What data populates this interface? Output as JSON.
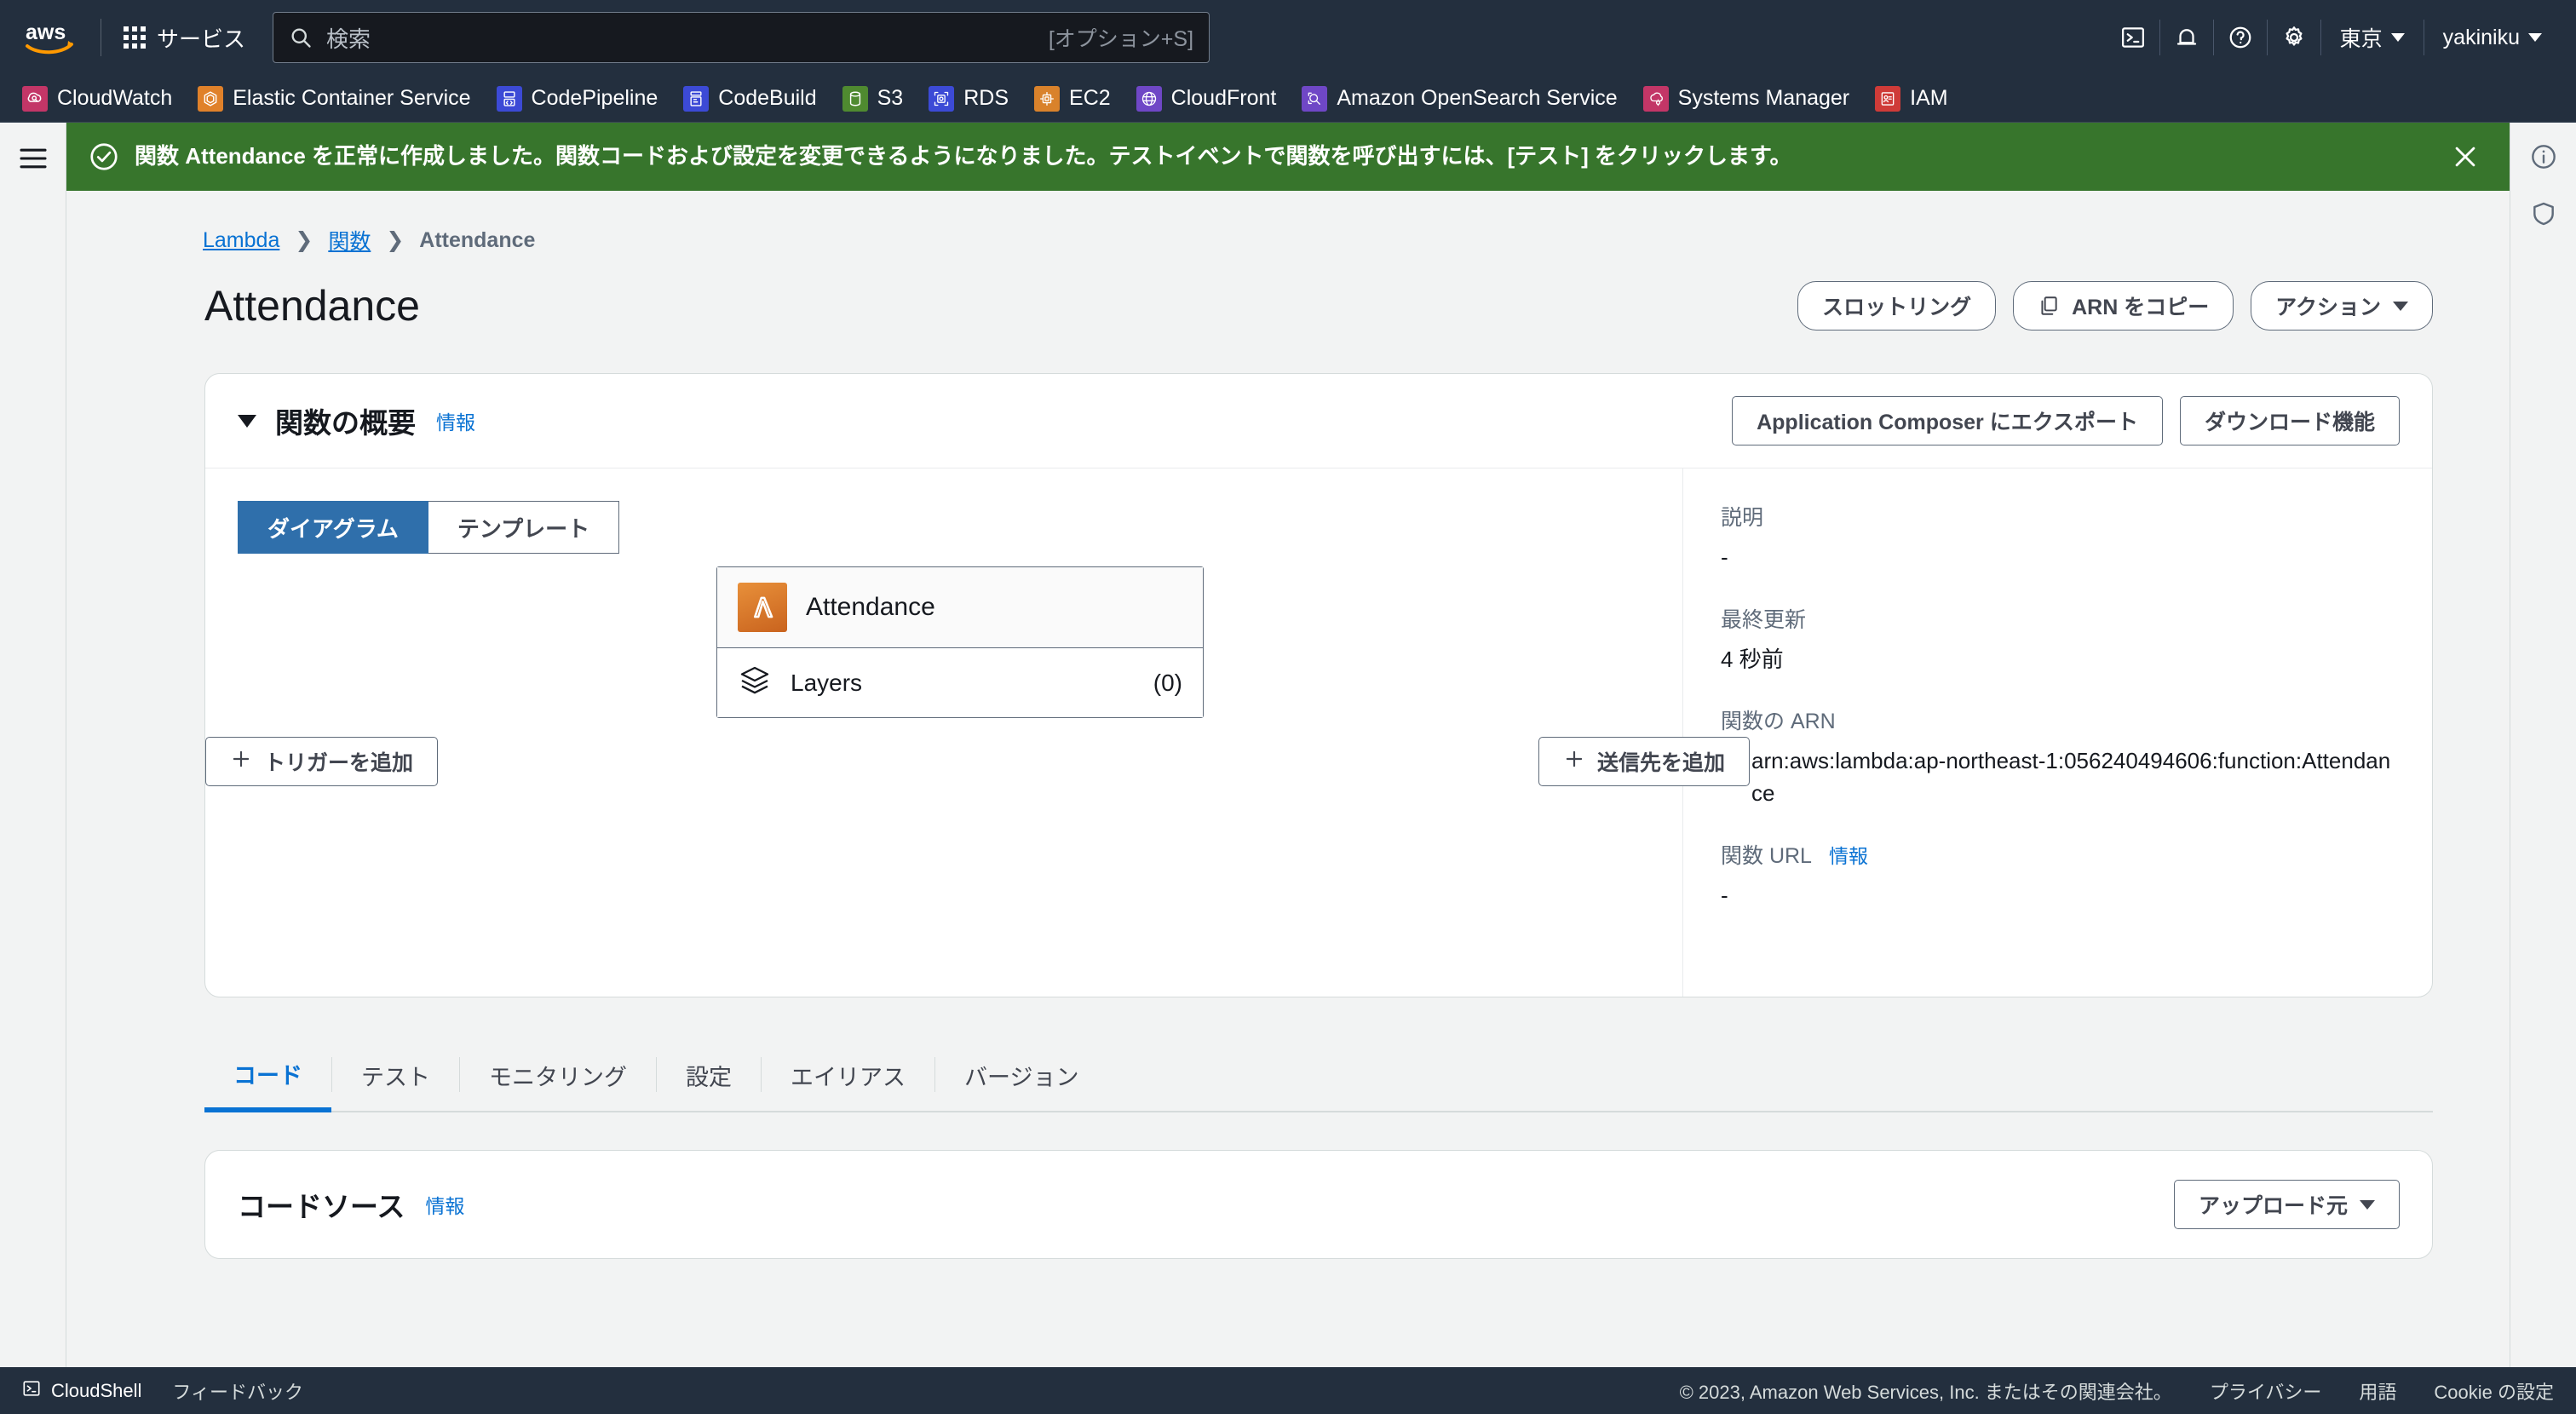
{
  "topnav": {
    "logo_alt": "aws",
    "services_label": "サービス",
    "search": {
      "placeholder": "検索",
      "shortcut": "[オプション+S]"
    },
    "icons": [
      "cloudshell-icon",
      "bell-icon",
      "help-icon",
      "settings-icon"
    ],
    "region": "東京",
    "account": "yakiniku"
  },
  "service_bar": [
    {
      "label": "CloudWatch",
      "color": "#c33667",
      "icon": "cloudwatch-icon"
    },
    {
      "label": "Elastic Container Service",
      "color": "#e0812a",
      "icon": "ecs-icon"
    },
    {
      "label": "CodePipeline",
      "color": "#3c4ad6",
      "icon": "codepipeline-icon"
    },
    {
      "label": "CodeBuild",
      "color": "#3c4ad6",
      "icon": "codebuild-icon"
    },
    {
      "label": "S3",
      "color": "#4f8a30",
      "icon": "s3-icon"
    },
    {
      "label": "RDS",
      "color": "#3c4ad6",
      "icon": "rds-icon"
    },
    {
      "label": "EC2",
      "color": "#d9822b",
      "icon": "ec2-icon"
    },
    {
      "label": "CloudFront",
      "color": "#6f47c6",
      "icon": "cloudfront-icon"
    },
    {
      "label": "Amazon OpenSearch Service",
      "color": "#6f47c6",
      "icon": "opensearch-icon"
    },
    {
      "label": "Systems Manager",
      "color": "#c33667",
      "icon": "systems-manager-icon"
    },
    {
      "label": "IAM",
      "color": "#cf3b38",
      "icon": "iam-icon"
    }
  ],
  "flash": {
    "icon": "success-check-icon",
    "message": "関数 Attendance を正常に作成しました。関数コードおよび設定を変更できるようになりました。テストイベントで関数を呼び出すには、[テスト] をクリックします。",
    "close_label": "×",
    "bg_color": "#37752c"
  },
  "breadcrumb": {
    "items": [
      {
        "label": "Lambda",
        "link": true
      },
      {
        "label": "関数",
        "link": true
      },
      {
        "label": "Attendance",
        "link": false
      }
    ],
    "separator": "❯"
  },
  "page": {
    "title": "Attendance",
    "actions": [
      {
        "label": "スロットリング",
        "icon": null,
        "name": "throttle-button"
      },
      {
        "label": "ARN をコピー",
        "icon": "copy-icon",
        "name": "copy-arn-button"
      },
      {
        "label": "アクション",
        "icon": "caret-down",
        "name": "actions-button"
      }
    ]
  },
  "overview": {
    "title": "関数の概要",
    "info_label": "情報",
    "actions": [
      {
        "label": "Application Composer にエクスポート",
        "name": "export-app-composer-button"
      },
      {
        "label": "ダウンロード機能",
        "name": "download-function-button"
      }
    ],
    "tabs": [
      {
        "label": "ダイアグラム",
        "active": true
      },
      {
        "label": "テンプレート",
        "active": false
      }
    ],
    "node": {
      "name": "Attendance",
      "icon": "lambda-icon",
      "layers_label": "Layers",
      "layers_count": "(0)",
      "layers_icon": "layers-icon"
    },
    "add_trigger_label": "トリガーを追加",
    "add_destination_label": "送信先を追加",
    "details": [
      {
        "label": "説明",
        "value": "-",
        "type": "text"
      },
      {
        "label": "最終更新",
        "value": "4 秒前",
        "type": "text"
      },
      {
        "label": "関数の ARN",
        "value": "arn:aws:lambda:ap-northeast-1:056240494606:function:Attendance",
        "type": "arn"
      },
      {
        "label": "関数 URL",
        "value": "-",
        "type": "text",
        "info_label": "情報"
      }
    ]
  },
  "tabs": [
    {
      "label": "コード",
      "active": true
    },
    {
      "label": "テスト",
      "active": false
    },
    {
      "label": "モニタリング",
      "active": false
    },
    {
      "label": "設定",
      "active": false
    },
    {
      "label": "エイリアス",
      "active": false
    },
    {
      "label": "バージョン",
      "active": false
    }
  ],
  "code_source": {
    "title": "コードソース",
    "info_label": "情報",
    "upload_label": "アップロード元"
  },
  "footer": {
    "cloudshell": "CloudShell",
    "feedback": "フィードバック",
    "copyright": "© 2023, Amazon Web Services, Inc. またはその関連会社。",
    "links": [
      "プライバシー",
      "用語",
      "Cookie の設定"
    ]
  },
  "colors": {
    "nav_bg": "#232f3e",
    "accent_link": "#0972d3",
    "success": "#37752c",
    "lambda_orange": "#d8761f",
    "segment_active": "#2f6fab"
  }
}
